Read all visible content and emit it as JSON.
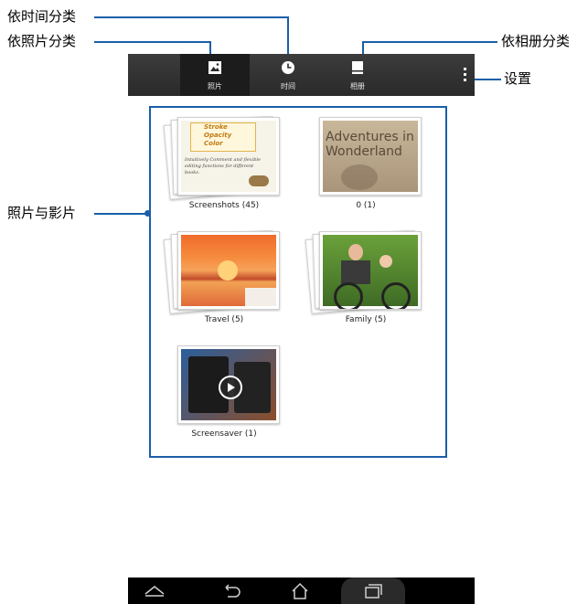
{
  "annotations": {
    "by_time": "依时间分类",
    "by_photo": "依照片分类",
    "by_album": "依相册分类",
    "settings": "设置",
    "photos_videos": "照片与影片"
  },
  "tabs": [
    {
      "label": "照片",
      "icon": "photo-icon"
    },
    {
      "label": "时间",
      "icon": "clock-icon"
    },
    {
      "label": "相册",
      "icon": "album-icon"
    }
  ],
  "albums": [
    {
      "caption": "Screenshots (45)",
      "thumb_lines": [
        "Stroke",
        "Opacity",
        "Color",
        "Intuitively Comment and flexible",
        "editing functions for different",
        "books."
      ]
    },
    {
      "caption": "0 (1)",
      "thumb_text": "Adventures in Wonderland"
    },
    {
      "caption": "Travel (5)"
    },
    {
      "caption": "Family (5)"
    },
    {
      "caption": "Screensaver (1)"
    }
  ],
  "colors": {
    "accent": "#1a5fa8",
    "actionbar": "#333333"
  },
  "navbar": [
    "back-icon",
    "home-icon",
    "recents-icon"
  ]
}
